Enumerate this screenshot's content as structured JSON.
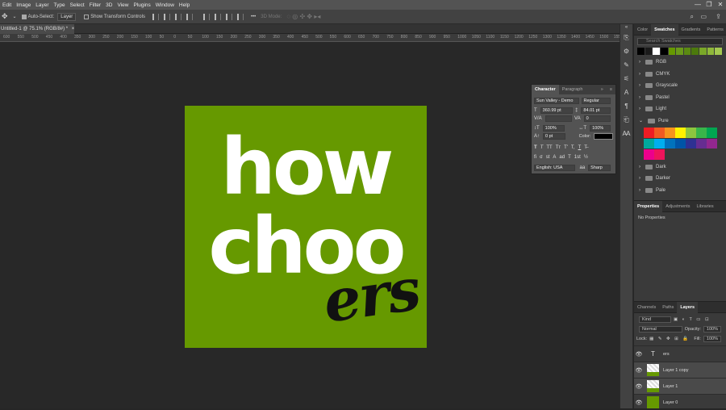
{
  "menu": [
    "Edit",
    "Image",
    "Layer",
    "Type",
    "Select",
    "Filter",
    "3D",
    "View",
    "Plugins",
    "Window",
    "Help"
  ],
  "window_controls": {
    "minimize": "—",
    "restore": "❐",
    "close": "✕"
  },
  "options": {
    "auto_select_label": "Auto-Select:",
    "auto_select_value": "Layer",
    "transform_label": "Show Transform Controls",
    "mode_3d": "3D Mode:",
    "more": "•••"
  },
  "document_tab": {
    "title": "Untitled-1 @ 75.1% (RGB/8#) *",
    "close": "×"
  },
  "ruler": [
    "600",
    "550",
    "500",
    "450",
    "400",
    "350",
    "300",
    "250",
    "200",
    "150",
    "100",
    "50",
    "0",
    "50",
    "100",
    "150",
    "200",
    "250",
    "300",
    "350",
    "400",
    "450",
    "500",
    "550",
    "600",
    "650",
    "700",
    "750",
    "800",
    "850",
    "900",
    "950",
    "1000",
    "1050",
    "1100",
    "1150",
    "1200",
    "1250",
    "1300",
    "1350",
    "1400",
    "1450",
    "1500",
    "1550"
  ],
  "artwork": {
    "word1": "how",
    "word2": "choo",
    "word3": "ers",
    "background": "#669900",
    "text_color": "#ffffff",
    "script_color": "#111111"
  },
  "character_panel": {
    "tabs": [
      "Character",
      "Paragraph"
    ],
    "font_family": "Sun Valley - Demo",
    "font_style": "Regular",
    "font_size": "360.99 pt",
    "leading": "84.01 pt",
    "kerning": "",
    "tracking": "0",
    "vertical_scale": "100%",
    "horizontal_scale": "100%",
    "baseline_shift": "0 pt",
    "color_label": "Color:",
    "language": "English: USA",
    "antialias": "Sharp",
    "style_glyphs": [
      "T",
      "T",
      "TT",
      "Tт",
      "T'",
      "T,",
      "T",
      "T̶"
    ],
    "opentype_glyphs": [
      "fi",
      "σ",
      "st",
      "A",
      "ad",
      "T",
      "1st",
      "½"
    ]
  },
  "swatches_panel": {
    "tabs": [
      "Color",
      "Swatches",
      "Gradients",
      "Patterns"
    ],
    "search_placeholder": "Search Swatches",
    "recent": [
      "#000000",
      "#1a1a1a",
      "#ffffff",
      "#000000",
      "#669900",
      "#6a9a1a",
      "#5b8a12",
      "#4c7a0c",
      "#7aa828",
      "#8fb83a",
      "#a3c850"
    ],
    "folders": [
      "RGB",
      "CMYK",
      "Grayscale",
      "Pastel",
      "Light",
      "Pure",
      "Dark",
      "Darker",
      "Pale"
    ],
    "pure_colors": [
      "#ee1c24",
      "#f15a22",
      "#f7941d",
      "#fff200",
      "#8dc63f",
      "#39b54a",
      "#00a651",
      "#00a99d",
      "#00aeef",
      "#0072bc",
      "#0054a6",
      "#2e3192",
      "#662d91",
      "#92278f",
      "#ec008c",
      "#ed145b"
    ]
  },
  "properties_panel": {
    "tabs": [
      "Properties",
      "Adjustments",
      "Libraries"
    ],
    "empty": "No Properties"
  },
  "layers_panel": {
    "tabs": [
      "Channels",
      "Paths",
      "Layers"
    ],
    "filter_kind": "Kind",
    "blend_mode": "Normal",
    "opacity_label": "Opacity:",
    "opacity_value": "100%",
    "lock_label": "Lock:",
    "fill_label": "Fill:",
    "fill_value": "100%",
    "layers": [
      {
        "name": "ers",
        "type": "text"
      },
      {
        "name": "Layer 1 copy",
        "type": "image"
      },
      {
        "name": "Layer 1",
        "type": "image"
      },
      {
        "name": "Layer 0",
        "type": "fill"
      }
    ]
  }
}
